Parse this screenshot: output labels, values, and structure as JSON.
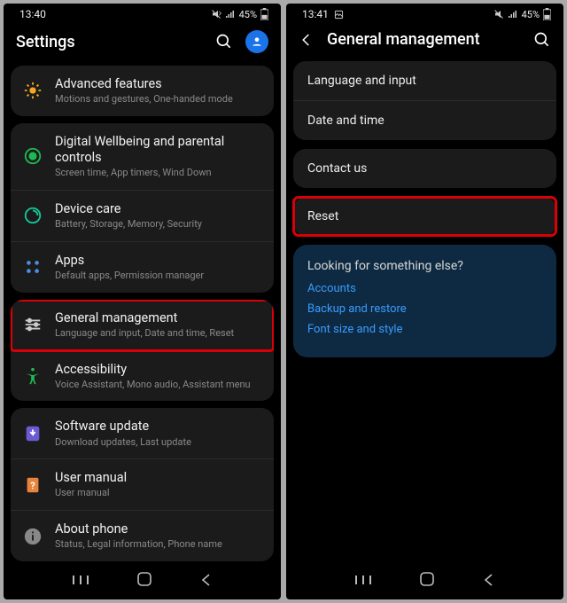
{
  "left": {
    "status": {
      "time": "13:40",
      "battery": "45%"
    },
    "header": "Settings",
    "groups": [
      [
        {
          "icon": "advanced",
          "title": "Advanced features",
          "sub": "Motions and gestures, One-handed mode"
        }
      ],
      [
        {
          "icon": "wellbeing",
          "title": "Digital Wellbeing and parental controls",
          "sub": "Screen time, App timers, Wind Down"
        },
        {
          "icon": "devicecare",
          "title": "Device care",
          "sub": "Battery, Storage, Memory, Security"
        },
        {
          "icon": "apps",
          "title": "Apps",
          "sub": "Default apps, Permission manager"
        }
      ],
      [
        {
          "icon": "general",
          "title": "General management",
          "sub": "Language and input, Date and time, Reset",
          "highlight": true
        },
        {
          "icon": "accessibility",
          "title": "Accessibility",
          "sub": "Voice Assistant, Mono audio, Assistant menu"
        }
      ],
      [
        {
          "icon": "update",
          "title": "Software update",
          "sub": "Download updates, Last update"
        },
        {
          "icon": "manual",
          "title": "User manual",
          "sub": "User manual"
        },
        {
          "icon": "about",
          "title": "About phone",
          "sub": "Status, Legal information, Phone name"
        }
      ]
    ]
  },
  "right": {
    "status": {
      "time": "13:41",
      "battery": "45%"
    },
    "header": "General management",
    "group1": [
      "Language and input",
      "Date and time"
    ],
    "contact": "Contact us",
    "reset": "Reset",
    "promo": {
      "q": "Looking for something else?",
      "links": [
        "Accounts",
        "Backup and restore",
        "Font size and style"
      ]
    }
  }
}
